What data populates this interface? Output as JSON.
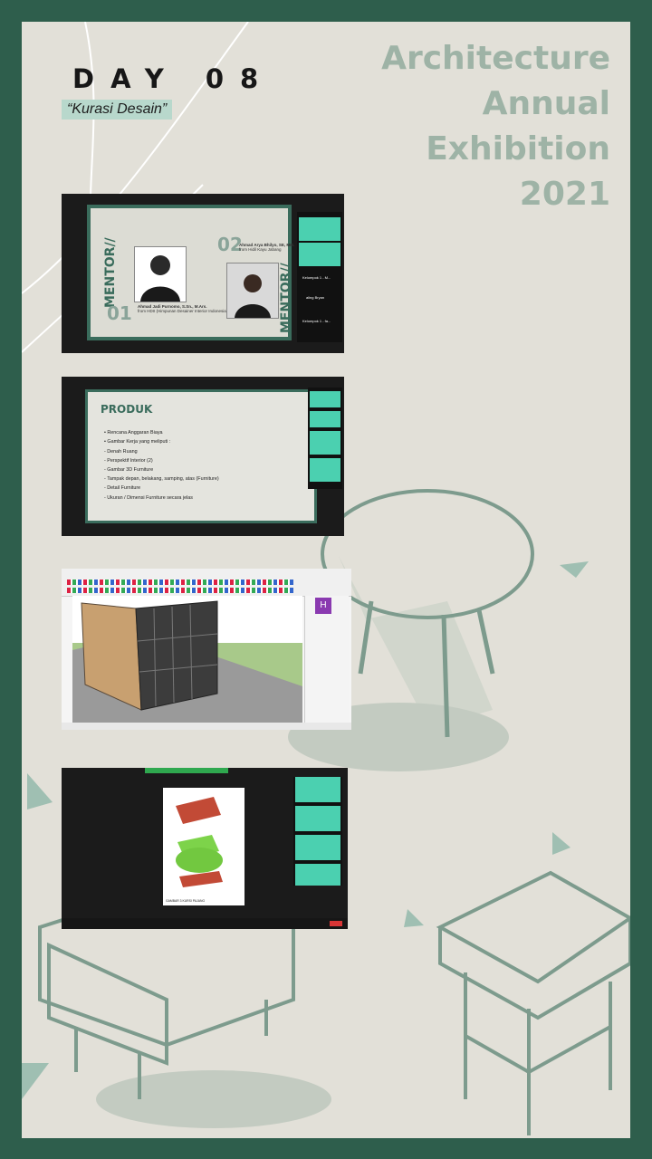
{
  "header": {
    "day": "DAY 08",
    "subtitle": "“Kurasi Desain”",
    "title_lines": [
      "Architecture",
      "Annual",
      "Exhibition",
      "2021"
    ]
  },
  "screenshot1": {
    "mentor_left_label": "MENTOR//",
    "mentor_right_label": "MENTOR//",
    "mentor1_number": "01",
    "mentor2_number": "02",
    "mentor1_name": "Ahmad Jadi Purnomo, S.Sn., M.Ars.",
    "mentor1_role": "from HDII (Himpunan Desainer Interior Indonesia)",
    "mentor2_name": "Ahmad Arya Bhilyo, SE, MM.",
    "mentor2_role": "from Hidil Kayu Jabang",
    "participants": [
      "Kelompok 1 - M...",
      "aling Bryan",
      "Kelompok 1 - fa..."
    ]
  },
  "screenshot2": {
    "heading": "PRODUK",
    "bullets": [
      "Rencana Anggaran Biaya",
      "Gambar Kerja yang  meliputi :"
    ],
    "dashes": [
      "- Denah Ruang",
      "- Perspektif Interior (2)",
      "- Gambar 3D Furniture",
      "- Tampak depan, belakang, samping, atas (Furniture)",
      "- Detail Furniture",
      "- Ukuran / Dimensi Furniture secara jelas"
    ]
  },
  "screenshot3": {
    "panel_letter": "H"
  },
  "screenshot4": {
    "doc_title": "GAMBAR 3 KURSI PAJANG"
  },
  "colors": {
    "frame": "#2e5e4c",
    "background": "#e2e0d8",
    "title": "#9eb3a6",
    "accent": "#3a6c5c",
    "highlight": "#b8d8cc"
  }
}
